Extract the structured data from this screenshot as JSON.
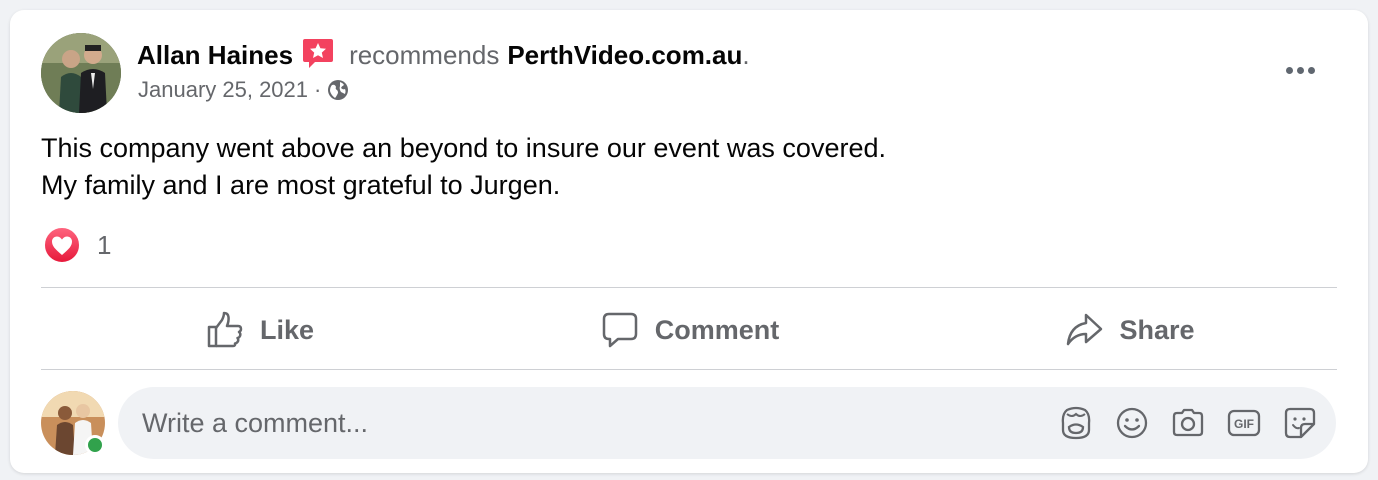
{
  "post": {
    "author": "Allan Haines",
    "action_text": "recommends",
    "page_name": "PerthVideo.com.au",
    "period": ".",
    "date": "January 25, 2021",
    "separator": "·",
    "audience_icon": "globe-icon",
    "body_line_1": "This company went above an beyond to insure our event was covered.",
    "body_line_2": "My family and I are most grateful to Jurgen.",
    "reaction_icon": "love-reaction-icon",
    "reaction_count": "1"
  },
  "actions": {
    "like_label": "Like",
    "comment_label": "Comment",
    "share_label": "Share"
  },
  "composer": {
    "placeholder": "Write a comment...",
    "icons": [
      "avatar-sticker-icon",
      "emoji-icon",
      "camera-icon",
      "gif-icon",
      "sticker-icon"
    ]
  },
  "colors": {
    "recommend_badge": "#f3425f",
    "love": "#f33e58",
    "online": "#31a24c",
    "secondary_text": "#65676b"
  }
}
